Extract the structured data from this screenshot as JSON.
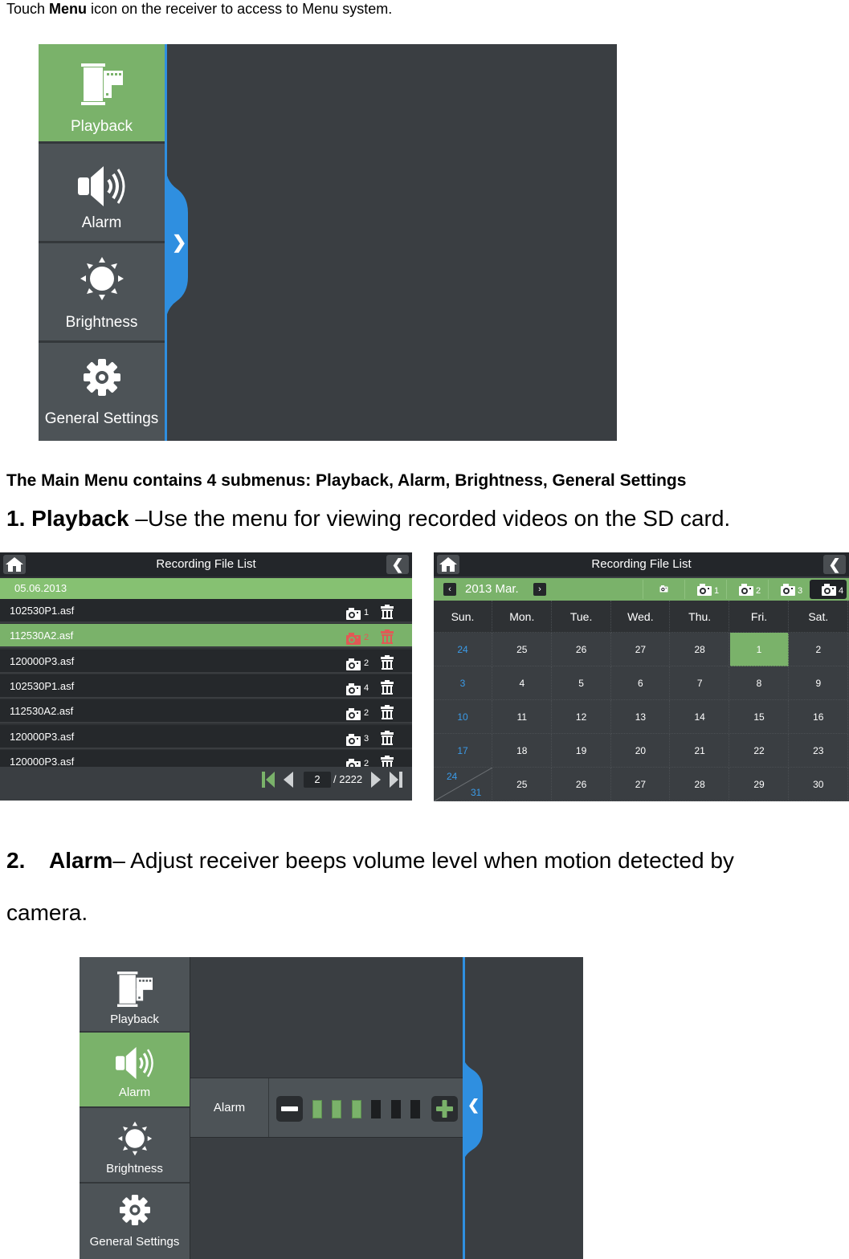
{
  "intro": {
    "prefix": "Touch ",
    "bold": "Menu",
    "suffix": " icon on the receiver to access to Menu system."
  },
  "main_menu": {
    "items": [
      {
        "label": "Playback",
        "icon": "film-icon",
        "active": true
      },
      {
        "label": "Alarm",
        "icon": "speaker-icon",
        "active": false
      },
      {
        "label": "Brightness",
        "icon": "sun-icon",
        "active": false
      },
      {
        "label": "General Settings",
        "icon": "gear-icon",
        "active": false
      }
    ],
    "expand_tab_glyph": "❯"
  },
  "summary": "The Main Menu contains 4 submenus: Playback, Alarm, Brightness, General Settings",
  "section1": {
    "number": "1.",
    "title": "Playback",
    "text": " –Use the menu for viewing recorded videos on the SD card."
  },
  "file_list": {
    "title": "Recording File List",
    "back_glyph": "❮",
    "date": "05.06.2013",
    "rows": [
      {
        "name": "102530P1.asf",
        "camera": "1",
        "selected": false
      },
      {
        "name": "112530A2.asf",
        "camera": "2",
        "selected": true
      },
      {
        "name": "120000P3.asf",
        "camera": "2",
        "selected": false
      },
      {
        "name": "102530P1.asf",
        "camera": "4",
        "selected": false
      },
      {
        "name": "112530A2.asf",
        "camera": "2",
        "selected": false
      },
      {
        "name": "120000P3.asf",
        "camera": "3",
        "selected": false
      },
      {
        "name": "120000P3.asf",
        "camera": "2",
        "selected": false
      }
    ],
    "pager": {
      "current_page": "2",
      "total": "/ 2222"
    }
  },
  "calendar": {
    "title": "Recording File List",
    "back_glyph": "❮",
    "month": "2013 Mar.",
    "prev_glyph": "‹",
    "next_glyph": "›",
    "camera_tabs": [
      {
        "label": "all",
        "selected": false
      },
      {
        "label": "1",
        "selected": false
      },
      {
        "label": "2",
        "selected": false
      },
      {
        "label": "3",
        "selected": false
      },
      {
        "label": "4",
        "selected": true
      }
    ],
    "weekdays": [
      "Sun.",
      "Mon.",
      "Tue.",
      "Wed.",
      "Thu.",
      "Fri.",
      "Sat."
    ],
    "weeks": [
      [
        "24",
        "25",
        "26",
        "27",
        "28",
        "1",
        "2"
      ],
      [
        "3",
        "4",
        "5",
        "6",
        "7",
        "8",
        "9"
      ],
      [
        "10",
        "11",
        "12",
        "13",
        "14",
        "15",
        "16"
      ],
      [
        "17",
        "18",
        "19",
        "20",
        "21",
        "22",
        "23"
      ],
      [
        "24/31",
        "25",
        "26",
        "27",
        "28",
        "29",
        "30"
      ]
    ],
    "highlighted_day": "1",
    "split_cell": {
      "top": "24",
      "bottom": "31"
    }
  },
  "section2": {
    "number": "2.",
    "title": "Alarm",
    "text": "– Adjust receiver beeps volume level when motion detected by",
    "continuation": "camera."
  },
  "alarm_menu": {
    "items": [
      {
        "label": "Playback",
        "icon": "film-icon",
        "active": false
      },
      {
        "label": "Alarm",
        "icon": "speaker-icon",
        "active": true
      },
      {
        "label": "Brightness",
        "icon": "sun-icon",
        "active": false
      },
      {
        "label": "General Settings",
        "icon": "gear-icon",
        "active": false
      }
    ],
    "setting_label": "Alarm",
    "volume_level": 3,
    "volume_max": 6,
    "collapse_tab_glyph": "❮"
  },
  "colors": {
    "accent_green": "#7ab26a",
    "accent_blue": "#2f8fe0",
    "panel_dark": "#3a3e42",
    "sunday_blue": "#3a9be8",
    "selected_red": "#e05a55"
  }
}
